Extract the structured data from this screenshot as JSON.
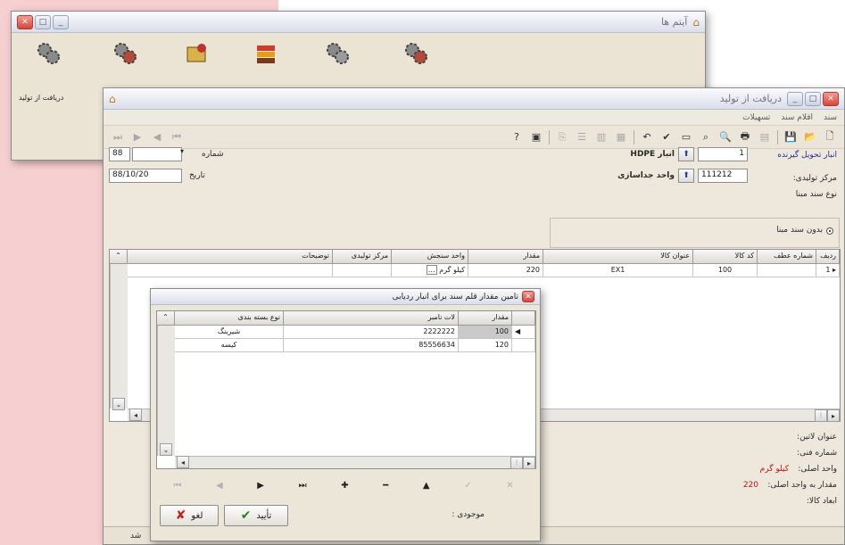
{
  "items_window": {
    "title": "آیتم ها",
    "items": [
      {
        "label": "دریافت از تولید",
        "icon": "gears-icon"
      }
    ]
  },
  "main_window": {
    "title": "دریافت از تولید",
    "menu": [
      "سند",
      "اقلام سند",
      "تسهیلات"
    ],
    "form": {
      "warehouse_label": "انبار تحویل گیرنده",
      "warehouse_code": "1",
      "warehouse_name": "انبار HDPE",
      "center_label": "مرکز تولیدی:",
      "center_code": "111212",
      "center_name": "واحد جداسازی",
      "number_label": "شماره",
      "number_value": "88",
      "date_label": "تاریخ",
      "date_value": "88/10/20",
      "base_doc_type_label": "نوع سند مبنا",
      "base_doc_option": "بدون سند مبنا"
    },
    "grid": {
      "headers": [
        "ردیف",
        "شماره عطف",
        "کد کالا",
        "عنوان کالا",
        "مقدار",
        "واحد سنجش",
        "مرکز تولیدی",
        "توضیحات"
      ],
      "row": {
        "index": "1",
        "ref": "",
        "code": "100",
        "title": "EX1",
        "qty": "220",
        "unit": "کیلو گرم",
        "center": "",
        "desc": ""
      }
    },
    "details": {
      "latin_title_label": "عنوان لاتین:",
      "tech_no_label": "شماره فنی:",
      "base_unit_label": "واحد اصلی:",
      "base_unit_value": "کیلو گرم",
      "qty_base_label": "مقدار به واحد اصلی:",
      "qty_base_value": "220",
      "dims_label": "ابعاد کالا:"
    },
    "status": "شد"
  },
  "dialog": {
    "title": "تامین مقدار قلم سند برای انبار ردیابی",
    "headers": [
      "مقدار",
      "لات نامبر",
      "نوع بسته بندی"
    ],
    "rows": [
      {
        "qty": "100",
        "lot": "2222222",
        "pack": "شیرینگ",
        "selected": true
      },
      {
        "qty": "120",
        "lot": "85556634",
        "pack": "کیسه",
        "selected": false
      }
    ],
    "stock_label": "موجودی :",
    "ok_label": "تأیید",
    "cancel_label": "لغو"
  }
}
